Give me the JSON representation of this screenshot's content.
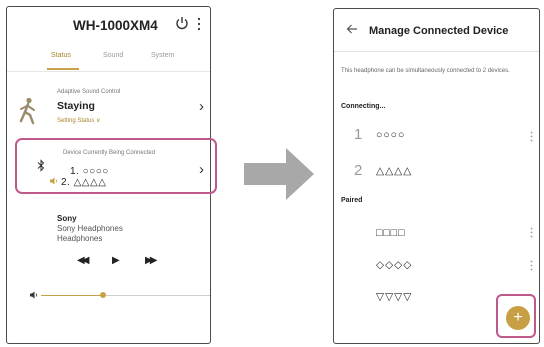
{
  "left_screen": {
    "header": {
      "title": "WH-1000XM4",
      "power_icon": "power-icon",
      "more_icon": "more-vertical-icon"
    },
    "tabs": [
      {
        "label": "Status",
        "active": true
      },
      {
        "label": "Sound",
        "active": false
      },
      {
        "label": "System",
        "active": false
      }
    ],
    "adaptive": {
      "label": "Adaptive Sound Control",
      "value": "Staying",
      "setting_link": "Setting Status ∨",
      "icon": "walking-person-icon"
    },
    "connected": {
      "label": "Device Currently Being Connected",
      "devices": [
        "1. ○○○○",
        "2. △△△△"
      ],
      "icon": "bluetooth-icon"
    },
    "now_playing": {
      "artist": "Sony",
      "lines": [
        "Sony Headphones",
        "Headphones"
      ]
    },
    "controls": {
      "prev": "◀◀",
      "play": "▶",
      "next": "▶▶"
    },
    "volume": {
      "level": 0.37
    }
  },
  "right_screen": {
    "header": {
      "title": "Manage Connected Device",
      "back_icon": "back-arrow-icon"
    },
    "description": "This headphone can be simultaneously connected to 2 devices.",
    "connecting": {
      "label": "Connecting...",
      "items": [
        {
          "num": "1",
          "name": "○○○○"
        },
        {
          "num": "2",
          "name": "△△△△"
        }
      ]
    },
    "paired": {
      "label": "Paired",
      "items": [
        {
          "name": "□□□□"
        },
        {
          "name": "◇◇◇◇"
        },
        {
          "name": "▽▽▽▽"
        }
      ]
    },
    "add_button": "+"
  },
  "colors": {
    "accent": "#c7a046",
    "highlight": "#c0598b",
    "arrow": "#a8a8a8"
  }
}
